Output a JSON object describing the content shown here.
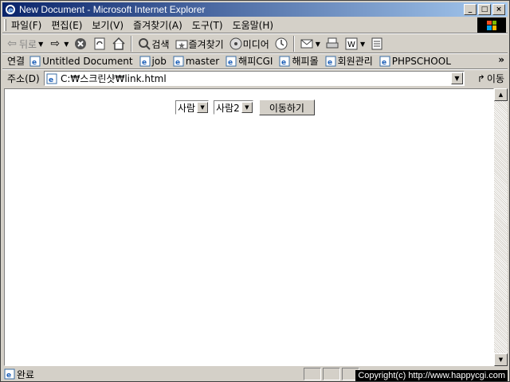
{
  "window": {
    "title": "New Document - Microsoft Internet Explorer"
  },
  "menu": [
    "파일(F)",
    "편집(E)",
    "보기(V)",
    "즐겨찾기(A)",
    "도구(T)",
    "도움말(H)"
  ],
  "toolbar": {
    "back": "뒤로",
    "search": "검색",
    "favorites": "즐겨찾기",
    "media": "미디어"
  },
  "links": {
    "label": "연결",
    "items": [
      "Untitled Document",
      "job",
      "master",
      "해피CGI",
      "해피몰",
      "회원관리",
      "PHPSCHOOL"
    ]
  },
  "address": {
    "label": "주소(D)",
    "value": "C:₩스크린샷₩link.html",
    "go": "이동"
  },
  "page": {
    "select1": "사람",
    "select2": "사람2",
    "button": "이동하기"
  },
  "status": {
    "text": "완료",
    "copyright": "Copyright(c) http://www.happycgi.com"
  }
}
